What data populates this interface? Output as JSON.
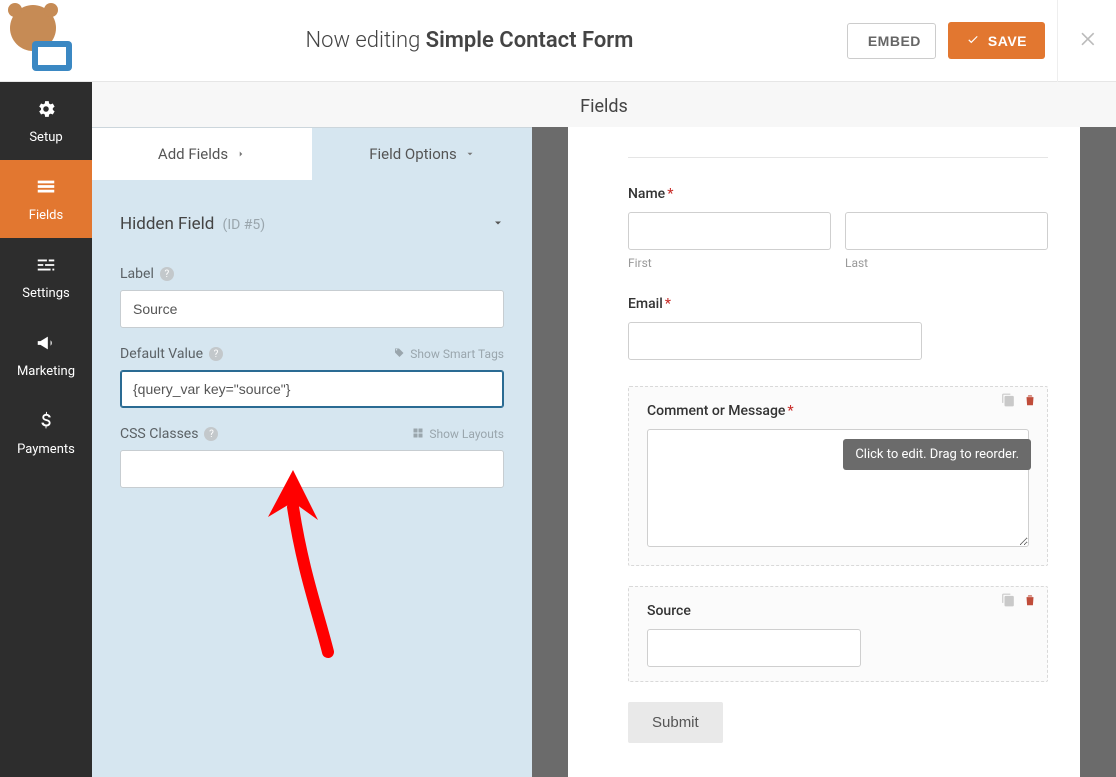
{
  "header": {
    "editing_prefix": "Now editing ",
    "form_name": "Simple Contact Form",
    "embed_label": "EMBED",
    "save_label": "SAVE"
  },
  "sidebar": {
    "items": [
      {
        "label": "Setup"
      },
      {
        "label": "Fields"
      },
      {
        "label": "Settings"
      },
      {
        "label": "Marketing"
      },
      {
        "label": "Payments"
      }
    ]
  },
  "panel": {
    "title": "Fields",
    "tabs": {
      "add_fields": "Add Fields",
      "field_options": "Field Options"
    }
  },
  "field_options": {
    "field_title": "Hidden Field",
    "field_id": "(ID #5)",
    "label_caption": "Label",
    "label_value": "Source",
    "default_value_caption": "Default Value",
    "show_smart_tags": "Show Smart Tags",
    "default_value_value": "{query_var key=\"source\"}",
    "css_classes_caption": "CSS Classes",
    "show_layouts": "Show Layouts",
    "css_classes_value": ""
  },
  "preview": {
    "name_label": "Name",
    "first_label": "First",
    "last_label": "Last",
    "email_label": "Email",
    "comment_label": "Comment or Message",
    "source_label": "Source",
    "submit_label": "Submit",
    "tooltip": "Click to edit. Drag to reorder."
  }
}
